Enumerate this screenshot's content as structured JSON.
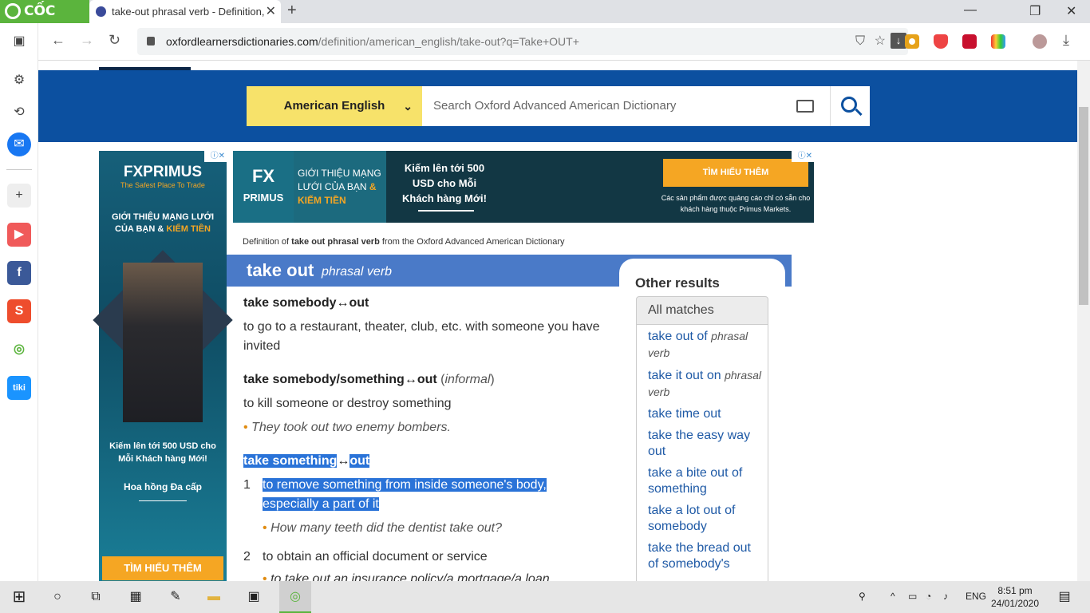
{
  "browser": {
    "brand": "CỐC CỐC",
    "tab_title": "take-out phrasal verb - Definition,",
    "tab_close": "✕",
    "new_tab": "+",
    "url_host": "oxfordlearnersdictionaries.com",
    "url_path": "/definition/american_english/take-out?q=Take+OUT+",
    "window": {
      "minimize": "—",
      "restore": "❐",
      "close": "✕"
    }
  },
  "site": {
    "language": "American English",
    "search_placeholder": "Search Oxford Advanced American Dictionary",
    "breadcrumb_pre": "Definition of ",
    "breadcrumb_bold": "take out phrasal verb",
    "breadcrumb_post": " from the Oxford Advanced American Dictionary"
  },
  "ads": {
    "left": {
      "brand": "FXPRIMUS",
      "tagline": "The Safest Place To Trade",
      "headline": "GIỚI THIỆU MẠNG LƯỚI CỦA BẠN &",
      "headline_accent": "KIẾM TIỀN",
      "offer": "Kiếm lên tới 500 USD cho Mỗi Khách hàng Mới!",
      "commission": "Hoa hồng Đa cấp",
      "cta": "TÌM HIỂU THÊM"
    },
    "top": {
      "brand_l1": "FX",
      "brand_l2": "PRIMUS",
      "intro": "GIỚI THIỆU MẠNG LƯỚI CỦA BẠN",
      "intro_accent": "& KIẾM TIỀN",
      "offer": "Kiếm lên tới 500 USD cho Mỗi Khách hàng Mới!",
      "cta": "TÌM HIỂU THÊM",
      "disclaimer": "Các sản phẩm được quảng cáo chỉ có sẵn cho khách hàng thuộc Primus Markets."
    }
  },
  "entry": {
    "headword": "take out",
    "pos": "phrasal verb",
    "senses": [
      {
        "phrase": "take somebody↔out",
        "definition": "to go to a restaurant, theater, club, etc. with someone you have invited"
      },
      {
        "phrase": "take somebody/something↔out",
        "register": "informal",
        "definition": "to kill someone or destroy something",
        "example": "They took out two enemy bombers."
      },
      {
        "phrase_a": "take something",
        "phrase_arrow": "↔",
        "phrase_b": "out",
        "items": [
          {
            "num": "1",
            "definition": "to remove something from inside someone's body, especially a part of it",
            "example": "How many teeth did the dentist take out?"
          },
          {
            "num": "2",
            "definition": "to obtain an official document or service",
            "example": "to take out an insurance policy/a mortgage/a loan"
          }
        ]
      }
    ]
  },
  "other_results": {
    "title": "Other results",
    "tab": "All matches",
    "items": [
      {
        "text": "take out of",
        "pos": "phrasal verb"
      },
      {
        "text": "take it out on",
        "pos": "phrasal verb"
      },
      {
        "text": "take time out",
        "pos": ""
      },
      {
        "text": "take the easy way out",
        "pos": ""
      },
      {
        "text": "take a bite out of something",
        "pos": ""
      },
      {
        "text": "take a lot out of somebody",
        "pos": ""
      },
      {
        "text": "take the bread out of somebody's",
        "pos": ""
      }
    ]
  },
  "taskbar": {
    "lang": "ENG",
    "time": "8:51 pm",
    "date": "24/01/2020"
  }
}
